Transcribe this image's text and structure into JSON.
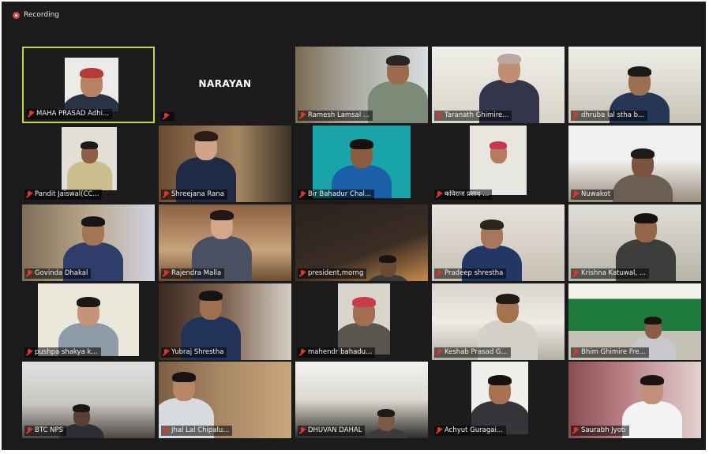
{
  "recording": {
    "label": "Recording",
    "indicator_color": "#d94a3a"
  },
  "active_speaker_color": "#c9d23a",
  "participants": [
    {
      "name": "MAHA PRASAD Adhi...",
      "muted": true,
      "video": true
    },
    {
      "name": "",
      "display_name": "NARAYAN",
      "muted": true,
      "video": false
    },
    {
      "name": "Ramesh Lamsal ...",
      "muted": true,
      "video": true
    },
    {
      "name": "Taranath Ghimire...",
      "muted": true,
      "video": true
    },
    {
      "name": "dhruba lal stha b...",
      "muted": true,
      "video": true
    },
    {
      "name": "Pandit Jaiswal(CC...",
      "muted": true,
      "video": true
    },
    {
      "name": "Shreejana Rana",
      "muted": true,
      "video": true
    },
    {
      "name": "Bir Bahadur Chal...",
      "muted": true,
      "video": true
    },
    {
      "name": "कविराज प्रसाद ...",
      "muted": true,
      "video": true
    },
    {
      "name": "Nuwakot",
      "muted": true,
      "video": true
    },
    {
      "name": "Govinda Dhakal",
      "muted": true,
      "video": true
    },
    {
      "name": "Rajendra Malla",
      "muted": true,
      "video": true
    },
    {
      "name": "president,morng",
      "muted": true,
      "video": true
    },
    {
      "name": "Pradeep shrestha",
      "muted": true,
      "video": true
    },
    {
      "name": "Krishna Katuwal, ...",
      "muted": true,
      "video": true
    },
    {
      "name": "pushpa shakya k...",
      "muted": true,
      "video": true
    },
    {
      "name": "Yubraj Shrestha",
      "muted": true,
      "video": true
    },
    {
      "name": "mahendr bahadu...",
      "muted": true,
      "video": true
    },
    {
      "name": "Keshab Prasad G...",
      "muted": true,
      "video": true
    },
    {
      "name": "Bhim Ghimire Fre...",
      "muted": true,
      "video": true
    },
    {
      "name": "BTC NPS",
      "muted": true,
      "video": true
    },
    {
      "name": "Jhal Lal Chipalu...",
      "muted": true,
      "video": true
    },
    {
      "name": "DHUVAN DAHAL",
      "muted": true,
      "video": true
    },
    {
      "name": "Achyut Guragai...",
      "muted": true,
      "video": true
    },
    {
      "name": "Saurabh Jyoti",
      "muted": true,
      "video": true
    }
  ]
}
